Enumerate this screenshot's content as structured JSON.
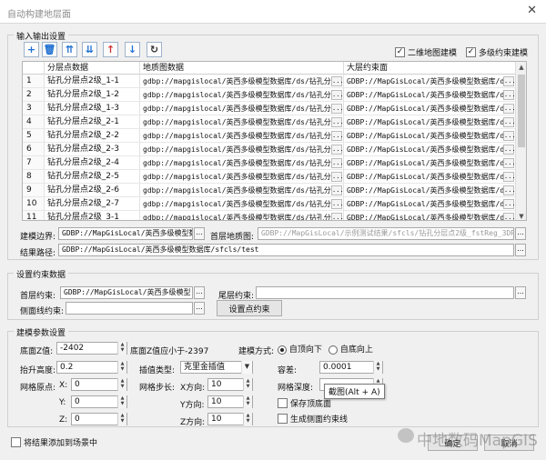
{
  "window": {
    "title": "自动构建地层面",
    "close": "✕"
  },
  "io": {
    "title": "输入输出设置",
    "toolbar": [
      {
        "name": "add-icon",
        "glyph": "+",
        "color": "#1f6fd1"
      },
      {
        "name": "delete-icon",
        "glyph": "🗑",
        "color": "#1f6fd1"
      },
      {
        "name": "move-top-icon",
        "glyph": "⇈",
        "color": "#1f6fd1"
      },
      {
        "name": "move-bottom-icon",
        "glyph": "⇊",
        "color": "#1f6fd1"
      },
      {
        "name": "move-up-icon",
        "glyph": "↑",
        "color": "#d13030"
      },
      {
        "name": "move-down-icon",
        "glyph": "↓",
        "color": "#1f6fd1"
      },
      {
        "name": "refresh-icon",
        "glyph": "↻",
        "color": "#333333"
      }
    ],
    "options": {
      "surface2d": "二维地图建模",
      "multiConstraint": "多级约束建模"
    },
    "columns": [
      "",
      "分层点数据",
      "地质图数据",
      "大层约束面"
    ],
    "rows": [
      {
        "n": "1",
        "layer": "钻孔分层点2级_1-1",
        "map": "gdbp://mapgislocal/英西多级模型数据库/ds/钻孔分...",
        "con": "GDBP://MapGisLocal/英西多级模型数据库/ds/..."
      },
      {
        "n": "2",
        "layer": "钻孔分层点2级_1-2",
        "map": "gdbp://mapgislocal/英西多级模型数据库/ds/钻孔分...",
        "con": "GDBP://MapGisLocal/英西多级模型数据库/ds/..."
      },
      {
        "n": "3",
        "layer": "钻孔分层点2级_1-3",
        "map": "gdbp://mapgislocal/英西多级模型数据库/ds/钻孔分...",
        "con": "GDBP://MapGisLocal/英西多级模型数据库/ds/..."
      },
      {
        "n": "4",
        "layer": "钻孔分层点2级_2-1",
        "map": "gdbp://mapgislocal/英西多级模型数据库/ds/钻孔分...",
        "con": "GDBP://MapGisLocal/英西多级模型数据库/ds/..."
      },
      {
        "n": "5",
        "layer": "钻孔分层点2级_2-2",
        "map": "gdbp://mapgislocal/英西多级模型数据库/ds/钻孔分...",
        "con": "GDBP://MapGisLocal/英西多级模型数据库/ds/..."
      },
      {
        "n": "6",
        "layer": "钻孔分层点2级_2-3",
        "map": "gdbp://mapgislocal/英西多级模型数据库/ds/钻孔分...",
        "con": "GDBP://MapGisLocal/英西多级模型数据库/ds/..."
      },
      {
        "n": "7",
        "layer": "钻孔分层点2级_2-4",
        "map": "gdbp://mapgislocal/英西多级模型数据库/ds/钻孔分...",
        "con": "GDBP://MapGisLocal/英西多级模型数据库/ds/..."
      },
      {
        "n": "8",
        "layer": "钻孔分层点2级_2-5",
        "map": "gdbp://mapgislocal/英西多级模型数据库/ds/钻孔分...",
        "con": "GDBP://MapGisLocal/英西多级模型数据库/ds/..."
      },
      {
        "n": "9",
        "layer": "钻孔分层点2级_2-6",
        "map": "gdbp://mapgislocal/英西多级模型数据库/ds/钻孔分...",
        "con": "GDBP://MapGisLocal/英西多级模型数据库/ds/..."
      },
      {
        "n": "10",
        "layer": "钻孔分层点2级_2-7",
        "map": "gdbp://mapgislocal/英西多级模型数据库/ds/钻孔分...",
        "con": "GDBP://MapGisLocal/英西多级模型数据库/ds/..."
      },
      {
        "n": "11",
        "layer": "钻孔分层点2级_3-1",
        "map": "gdbp://mapgislocal/英西多级模型数据库/ds/钻孔分...",
        "con": "GDBP://MapGisLocal/英西多级模型数据库/ds/..."
      }
    ],
    "boundaryLabel": "建模边界:",
    "boundaryValue": "GDBP://MapGisLocal/英西多级模型数据库/ds/...",
    "topMapLabel": "首层地质图:",
    "topMapValue": "GDBP://MapGisLocal/示例测试结果/sfcls/钻孔分层点2级_fstReg_3DReg",
    "resultLabel": "结果路径:",
    "resultValue": "GDBP://MapGisLocal/英西多级模型数据库/sfcls/test",
    "ellipsis": "..."
  },
  "constraint": {
    "title": "设置约束数据",
    "topLabel": "首层约束:",
    "topValue": "GDBP://MapGisLocal/英西多级模型",
    "tailLabel": "尾层约束:",
    "tailValue": "",
    "sideLabel": "侧面线约束:",
    "sideValue": "",
    "setPointButton": "设置点约束"
  },
  "params": {
    "title": "建模参数设置",
    "bottomZLabel": "底面Z值:",
    "bottomZValue": "-2402",
    "bottomZHint": "底面Z值应小于-2397",
    "buildModeLabel": "建模方式:",
    "topDown": "自顶向下",
    "bottomUp": "自底向上",
    "liftLabel": "抬升高度:",
    "liftValue": "0.2",
    "interpTypeLabel": "插值类型:",
    "interpTypeValue": "克里金插值",
    "toleranceLabel": "容差:",
    "toleranceValue": "0.0001",
    "originLabel": "网格原点:",
    "xLabel": "X:",
    "yLabel": "Y:",
    "zLabel": "Z:",
    "originX": "0",
    "originY": "0",
    "originZ": "0",
    "stepLabel": "网格步长:",
    "xDirLabel": "X方向:",
    "yDirLabel": "Y方向:",
    "zDirLabel": "Z方向:",
    "stepX": "10",
    "stepY": "10",
    "stepZ": "10",
    "depthLabel": "网格深度:",
    "depthValue": "",
    "keepTop": "保存顶底面",
    "genSideLines": "生成侧面约束线",
    "tooltip": "截图(Alt + A)"
  },
  "footer": {
    "addToScene": "将结果添加到场景中",
    "okButton": "确定",
    "cancelButton": "取消",
    "watermark": "中地数码MapGIS"
  }
}
